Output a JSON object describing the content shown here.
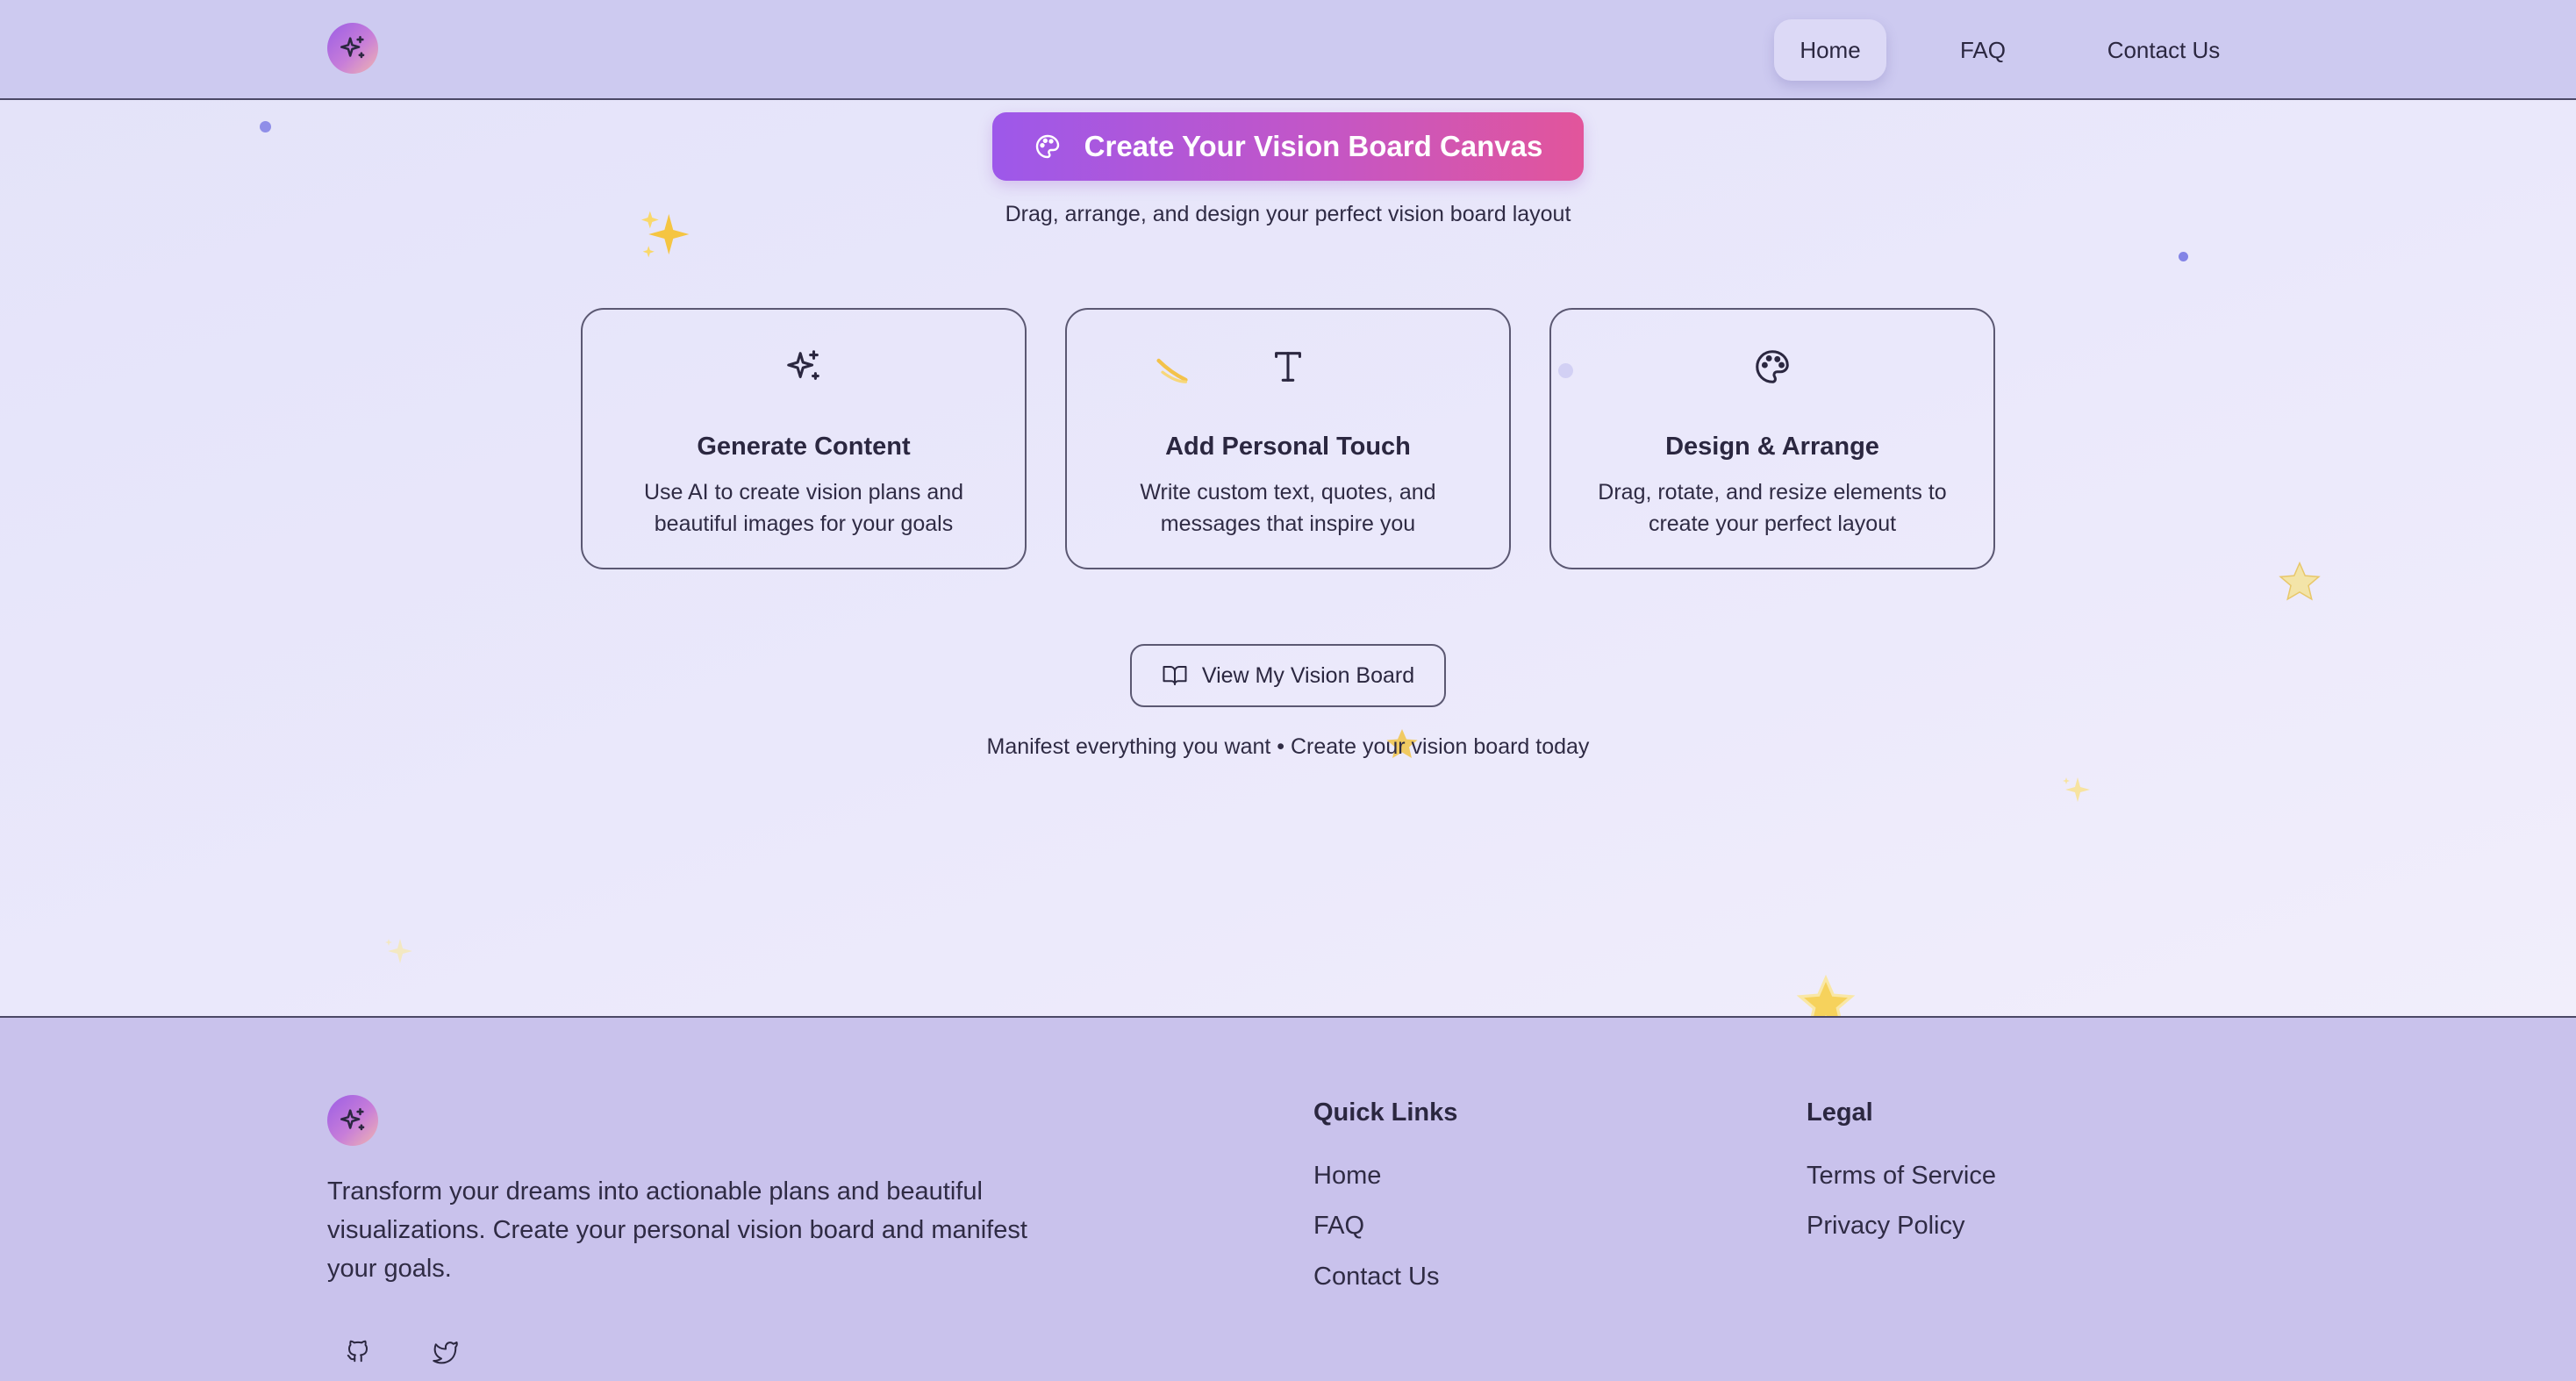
{
  "nav": {
    "items": [
      "Home",
      "FAQ",
      "Contact Us"
    ],
    "active": "Home"
  },
  "hero": {
    "cta_label": "Create Your Vision Board Canvas",
    "subtitle": "Drag, arrange, and design your perfect vision board layout"
  },
  "features": [
    {
      "icon": "sparkles-icon",
      "title": "Generate Content",
      "description": "Use AI to create vision plans and beautiful images for your goals"
    },
    {
      "icon": "type-icon",
      "title": "Add Personal Touch",
      "description": "Write custom text, quotes, and messages that inspire you"
    },
    {
      "icon": "palette-icon",
      "title": "Design & Arrange",
      "description": "Drag, rotate, and resize elements to create your perfect layout"
    }
  ],
  "view_button": {
    "label": "View My Vision Board",
    "icon": "book-open-icon"
  },
  "tagline": "Manifest everything you want • Create your vision board today",
  "footer": {
    "description": "Transform your dreams into actionable plans and beautiful visualizations. Create your personal vision board and manifest your goals.",
    "quick_links": {
      "title": "Quick Links",
      "items": [
        "Home",
        "FAQ",
        "Contact Us"
      ]
    },
    "legal": {
      "title": "Legal",
      "items": [
        "Terms of Service",
        "Privacy Policy"
      ]
    },
    "social": [
      "github-icon",
      "twitter-icon"
    ]
  },
  "colors": {
    "header_bg": "#cdcaf0",
    "footer_bg": "#c9c2ec",
    "cta_gradient_start": "#9d58ea",
    "cta_gradient_end": "#e2559b"
  }
}
